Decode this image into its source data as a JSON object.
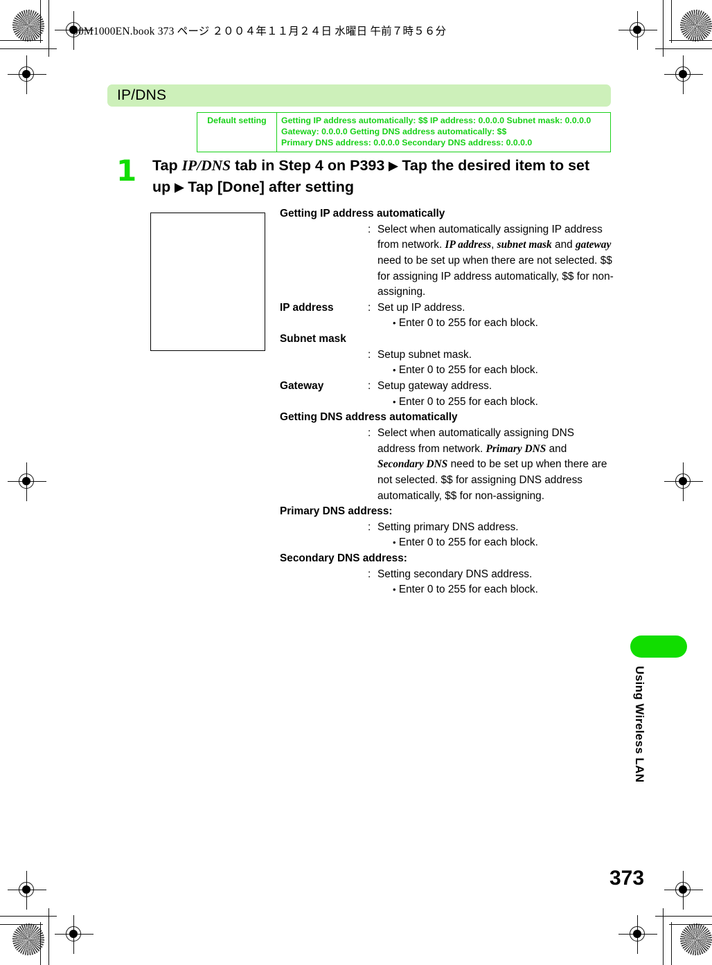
{
  "header": {
    "running_head": "00M1000EN.book   373 ページ   ２００４年１１月２４日   水曜日   午前７時５６分"
  },
  "section": {
    "banner_title": "IP/DNS",
    "banner_color": "#cdf0ba",
    "accent_color": "#11dd00"
  },
  "default_table": {
    "label": "Default setting",
    "lines": [
      "Getting IP address automatically: $$    IP address: 0.0.0.0    Subnet mask: 0.0.0.0",
      "Gateway: 0.0.0.0   Getting DNS address automatically: $$",
      "Primary DNS address: 0.0.0.0   Secondary DNS address: 0.0.0.0"
    ]
  },
  "step": {
    "number": "1",
    "part1": "Tap ",
    "italic1": "IP/DNS",
    "part2": " tab in Step 4 on P393 ",
    "arrow1": "▶",
    "part3": " Tap the desired item to set up ",
    "arrow2": "▶",
    "part4": " Tap [Done] after setting"
  },
  "definitions": [
    {
      "term": "Getting IP address automatically",
      "term_on_own_line": true,
      "colon": ":",
      "desc_part1": "Select when automatically assigning IP address from network. ",
      "italic_a": "IP address",
      "desc_part2": ", ",
      "italic_b": "subnet mask",
      "desc_part3": " and ",
      "italic_c": "gateway",
      "desc_part4": " need to be set up when there are not selected. $$ for assigning IP address automatically, $$ for non-assigning.",
      "bullets": []
    },
    {
      "term": "IP address",
      "term_on_own_line": false,
      "colon": ":",
      "desc_part1": "Set up IP address.",
      "bullets": [
        "Enter 0 to 255 for each block."
      ]
    },
    {
      "term": "Subnet mask",
      "term_on_own_line": true,
      "colon": ":",
      "desc_part1": "Setup subnet mask.",
      "bullets": [
        "Enter 0 to 255 for each block."
      ]
    },
    {
      "term": "Gateway",
      "term_on_own_line": false,
      "colon": ":",
      "desc_part1": "Setup gateway address.",
      "bullets": [
        "Enter 0 to 255 for each block."
      ]
    },
    {
      "term": "Getting DNS address automatically",
      "term_on_own_line": true,
      "colon": ":",
      "desc_part1": "Select when automatically assigning DNS address from network. ",
      "italic_a": "Primary DNS",
      "desc_part2": " and ",
      "italic_b": "Secondary DNS",
      "desc_part3": " need to be set up when there are not selected. $$ for assigning DNS address automatically, $$ for non-assigning.",
      "bullets": []
    },
    {
      "term": "Primary DNS address:",
      "term_on_own_line": true,
      "colon": ":",
      "desc_part1": "Setting primary DNS address.",
      "bullets": [
        "Enter 0 to 255 for each block."
      ]
    },
    {
      "term": "Secondary DNS address:",
      "term_on_own_line": true,
      "colon": ":",
      "desc_part1": "Setting secondary DNS address.",
      "bullets": [
        "Enter 0 to 255 for each block."
      ]
    }
  ],
  "side_tab": {
    "label": "Using Wireless LAN"
  },
  "footer": {
    "page_number": "373"
  },
  "bullet_glyph": "•"
}
